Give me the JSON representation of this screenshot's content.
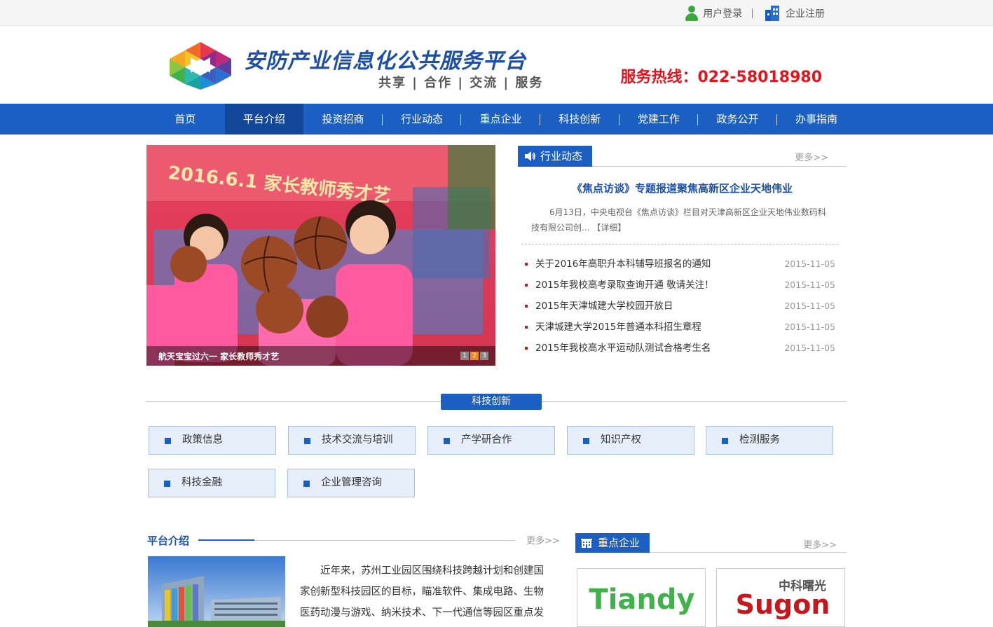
{
  "topbar": {
    "login": "用户登录",
    "separator": "|",
    "register": "企业注册"
  },
  "header": {
    "title": "安防产业信息化公共服务平台",
    "slogan": "共享 | 合作 | 交流 | 服务",
    "hotline": "服务热线：022-58018980"
  },
  "nav": {
    "items": [
      "首页",
      "平台介绍",
      "投资招商",
      "行业动态",
      "重点企业",
      "科技创新",
      "党建工作",
      "政务公开",
      "办事指南"
    ],
    "active_index": 1
  },
  "slider": {
    "caption": "航天宝宝过六一 家长教师秀才艺",
    "pages": [
      "1",
      "2",
      "3"
    ],
    "active_page": "2",
    "banner_text": "2016.6.1 家长教师秀才艺"
  },
  "news": {
    "tab_label": "行业动态",
    "more": "更多>>",
    "headline": "《焦点访谈》专题报道聚焦高新区企业天地伟业",
    "summary": "6月13日，中央电视台《焦点访谈》栏目对天津高新区企业天地伟业数码科技有限公司创...",
    "detail": "【详细】",
    "items": [
      {
        "title": "关于2016年高职升本科辅导班报名的通知",
        "date": "2015-11-05"
      },
      {
        "title": "2015年我校高考录取查询开通 敬请关注！",
        "date": "2015-11-05"
      },
      {
        "title": "2015年天津城建大学校园开放日",
        "date": "2015-11-05"
      },
      {
        "title": "天津城建大学2015年普通本科招生章程",
        "date": "2015-11-05"
      },
      {
        "title": "2015年我校高水平运动队测试合格考生名",
        "date": "2015-11-05"
      }
    ]
  },
  "tech": {
    "title": "科技创新",
    "items": [
      "政策信息",
      "技术交流与培训",
      "产学研合作",
      "知识产权",
      "检测服务",
      "科技金融",
      "企业管理咨询"
    ]
  },
  "intro": {
    "title": "平台介绍",
    "more": "更多>>",
    "text": "近年来，苏州工业园区围绕科技跨越计划和创建国家创新型科技园区的目标，瞄准软件、集成电路、生物医药动漫与游戏、纳米技术、下一代通信等园区重点发展产业"
  },
  "enterprises": {
    "tab_label": "重点企业",
    "more": "更多>>",
    "logos": [
      {
        "name": "Tiandy",
        "color": "#3fb24a"
      },
      {
        "name": "Sugon",
        "subtitle": "中科曙光",
        "color": "#c8161d"
      }
    ]
  },
  "colors": {
    "brand_blue": "#1c5fc2",
    "hotline_red": "#e3141c",
    "title_blue": "#1c4fa8"
  },
  "icons": [
    "user-icon",
    "building-icon",
    "speaker-icon",
    "enterprise-icon",
    "logo-mark"
  ]
}
